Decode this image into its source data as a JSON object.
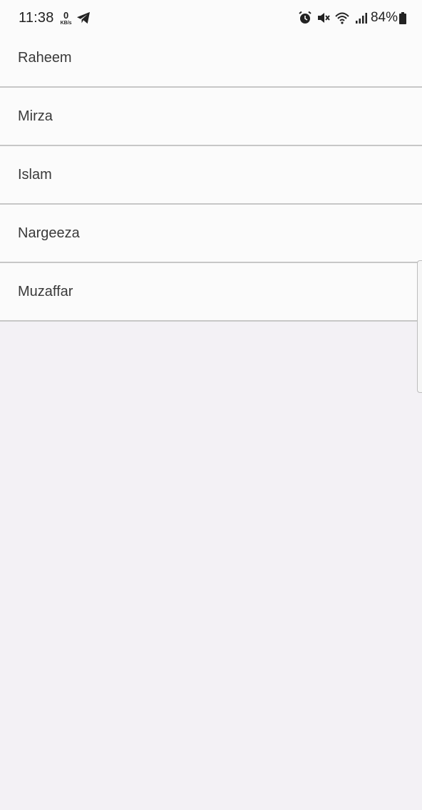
{
  "status_bar": {
    "time": "11:38",
    "data_speed_value": "0",
    "data_speed_unit": "KB/s",
    "battery": "84%",
    "icons": [
      "telegram-icon",
      "alarm-icon",
      "mute-icon",
      "wifi-icon",
      "signal-icon",
      "battery-icon"
    ]
  },
  "list": {
    "items": [
      {
        "label": "Raheem"
      },
      {
        "label": "Mirza"
      },
      {
        "label": "Islam"
      },
      {
        "label": "Nargeeza"
      },
      {
        "label": "Muzaffar"
      }
    ]
  }
}
